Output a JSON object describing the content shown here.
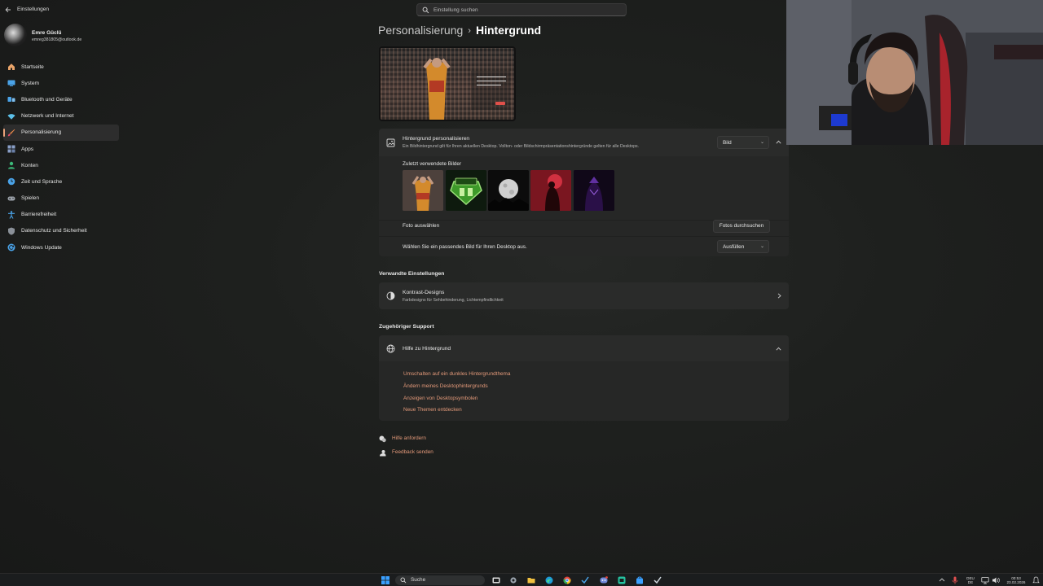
{
  "window": {
    "title": "Einstellungen"
  },
  "search": {
    "placeholder": "Einstellung suchen"
  },
  "profile": {
    "name": "Emre Güclü",
    "email": "emreg381805@outlook.de"
  },
  "sidebar": {
    "items": [
      {
        "label": "Startseite",
        "icon": "home-icon",
        "color": "#e9a46a"
      },
      {
        "label": "System",
        "icon": "system-icon",
        "color": "#4aa3e8"
      },
      {
        "label": "Bluetooth und Geräte",
        "icon": "bluetooth-icon",
        "color": "#4aa3e8"
      },
      {
        "label": "Netzwerk und Internet",
        "icon": "wifi-icon",
        "color": "#5cc0e8"
      },
      {
        "label": "Personalisierung",
        "icon": "brush-icon",
        "color": "#e8884a",
        "active": true
      },
      {
        "label": "Apps",
        "icon": "apps-icon",
        "color": "#8aa0c8"
      },
      {
        "label": "Konten",
        "icon": "account-icon",
        "color": "#3cba7a"
      },
      {
        "label": "Zeit und Sprache",
        "icon": "globe-clock-icon",
        "color": "#4aa3e8"
      },
      {
        "label": "Spielen",
        "icon": "gamepad-icon",
        "color": "#9aa0a8"
      },
      {
        "label": "Barrierefreiheit",
        "icon": "accessibility-icon",
        "color": "#4aa3e8"
      },
      {
        "label": "Datenschutz und Sicherheit",
        "icon": "shield-icon",
        "color": "#8a9098"
      },
      {
        "label": "Windows Update",
        "icon": "update-icon",
        "color": "#4aa3e8"
      }
    ]
  },
  "breadcrumb": {
    "parent": "Personalisierung",
    "separator": "›",
    "current": "Hintergrund"
  },
  "background_card": {
    "title": "Hintergrund personalisieren",
    "subtitle": "Ein Bildhintergrund gilt für Ihren aktuellen Desktop. Vollton- oder Bildschirmpräsentationshintergründe gelten für alle Desktops.",
    "type_value": "Bild",
    "recent_label": "Zuletzt verwendete Bilder",
    "thumbnails": [
      "football-player-thumb",
      "emre-logo-thumb",
      "moon-thumb",
      "red-figure-thumb",
      "purple-panther-thumb"
    ],
    "choose_photo_label": "Foto auswählen",
    "browse_button": "Fotos durchsuchen",
    "fit_label": "Wählen Sie ein passendes Bild für Ihren Desktop aus.",
    "fit_value": "Ausfüllen"
  },
  "related": {
    "heading": "Verwandte Einstellungen",
    "contrast_title": "Kontrast-Designs",
    "contrast_sub": "Farbdesigns für Sehbehinderung, Lichtempfindlichkeit"
  },
  "support": {
    "heading": "Zugehöriger Support",
    "help_title": "Hilfe zu Hintergrund",
    "links": [
      "Umschalten auf ein dunkles Hintergrundthema",
      "Ändern meines Desktophintergrunds",
      "Anzeigen von Desktopsymbolen",
      "Neue Themen entdecken"
    ]
  },
  "footer_links": {
    "help": "Hilfe anfordern",
    "feedback": "Feedback senden"
  },
  "taskbar": {
    "search_label": "Suche",
    "lang_top": "DEU",
    "lang_bottom": "DE",
    "time": "00:53",
    "date": "23.02.2026"
  },
  "colors": {
    "accent": "#e8884a",
    "link": "#e49a7a"
  }
}
